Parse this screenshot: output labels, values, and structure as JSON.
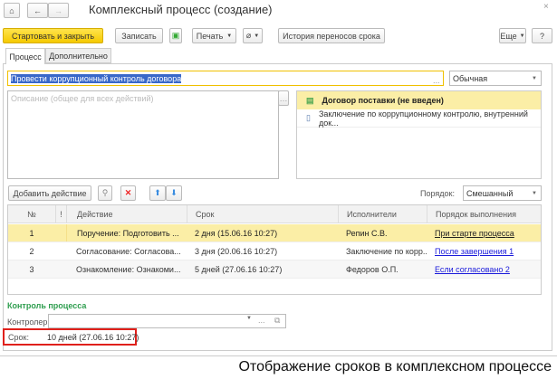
{
  "window": {
    "title": "Комплексный процесс (создание)",
    "close": "×"
  },
  "toolbar": {
    "start_close": "Стартовать и закрыть",
    "save": "Записать",
    "print": "Печать",
    "history": "История переносов срока",
    "more": "Еще",
    "help": "?"
  },
  "tabs": [
    {
      "label": "Процесс",
      "active": true
    },
    {
      "label": "Дополнительно",
      "active": false
    }
  ],
  "process": {
    "name": "Провести коррупционный контроль договора",
    "importance": "Обычная",
    "description_placeholder": "Описание (общее для всех действий)"
  },
  "attachments": [
    {
      "label": "Договор поставки (не введен)",
      "icon": "document-check-icon",
      "selected": true
    },
    {
      "label": "Заключение по коррупционному контролю, внутренний док...",
      "icon": "document-warning-icon",
      "selected": false
    }
  ],
  "actions_toolbar": {
    "add": "Добавить действие",
    "order_label": "Порядок:",
    "order_value": "Смешанный"
  },
  "table": {
    "headers": [
      "№",
      "!",
      "Действие",
      "Срок",
      "Исполнители",
      "Порядок выполнения"
    ],
    "rows": [
      {
        "num": "1",
        "action": "Поручение: Подготовить ...",
        "term": "2 дня (15.06.16 10:27)",
        "performers": "Репин С.В.",
        "order": "При старте процесса",
        "selected": true
      },
      {
        "num": "2",
        "action": "Согласование: Согласова...",
        "term": "3 дня (20.06.16 10:27)",
        "performers": "Заключение по корр...",
        "order": "После завершения 1",
        "selected": false
      },
      {
        "num": "3",
        "action": "Ознакомление: Ознакоми...",
        "term": "5 дней (27.06.16 10:27)",
        "performers": "Федоров О.П.",
        "order": "Если согласовано 2",
        "selected": false
      }
    ]
  },
  "control": {
    "title": "Контроль процесса",
    "controller_label": "Контролер:",
    "controller_value": "",
    "term_label": "Срок:",
    "term_value": "10 дней (27.06.16 10:27)"
  },
  "caption": "Отображение сроков в комплексном процессе",
  "colors": {
    "accent_yellow": "#f5c900",
    "selected_row": "#fbeea6",
    "link": "#1a1adb",
    "section_title": "#2f9e4f",
    "highlight_box": "#e0201b"
  }
}
